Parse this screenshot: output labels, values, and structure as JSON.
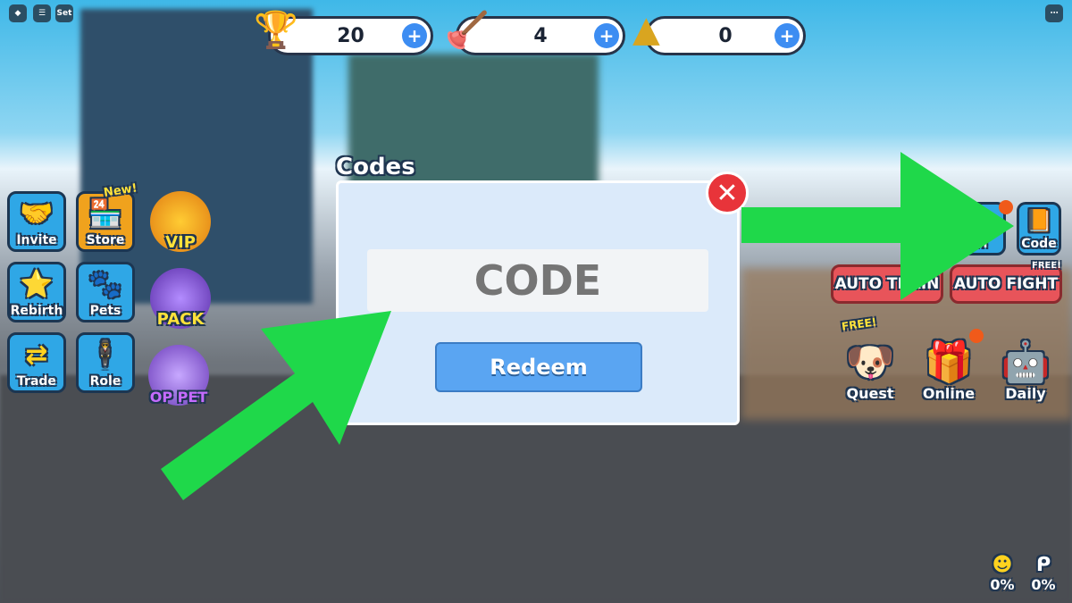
{
  "topbar": {
    "roblox": "roblox-logo",
    "chat": "chat-icon",
    "settings_label": "Set"
  },
  "counters": [
    {
      "icon": "trophy-icon",
      "value": "20"
    },
    {
      "icon": "plunger-icon",
      "value": "4"
    },
    {
      "icon": "bullet-icon",
      "value": "0"
    }
  ],
  "left_buttons": [
    {
      "label": "Invite",
      "icon": "handshake-icon"
    },
    {
      "label": "Store",
      "icon": "store-icon",
      "badge": "New!"
    },
    {
      "label": "Rebirth",
      "icon": "winged-star-icon"
    },
    {
      "label": "Pets",
      "icon": "paw-icon"
    },
    {
      "label": "Trade",
      "icon": "trade-arrows-icon"
    },
    {
      "label": "Role",
      "icon": "character-icon"
    }
  ],
  "promo": [
    {
      "label": "VIP"
    },
    {
      "label": "PACK"
    },
    {
      "label": "OP PET"
    }
  ],
  "dialog": {
    "title": "Codes",
    "placeholder": "CODE",
    "redeem": "Redeem"
  },
  "right": {
    "spin_partial": "pin",
    "code": "Code",
    "auto_train": "AUTO TRAIN",
    "auto_fight": "AUTO FIGHT",
    "free_tag": "FREE!",
    "quest": "Quest",
    "quest_tag": "FREE!",
    "online": "Online",
    "daily": "Daily"
  },
  "bottom_right": [
    {
      "value": "0%"
    },
    {
      "value": "0%"
    }
  ],
  "colors": {
    "arrow": "#1fd84a",
    "accent": "#3d8df2",
    "red": "#e8545a"
  }
}
